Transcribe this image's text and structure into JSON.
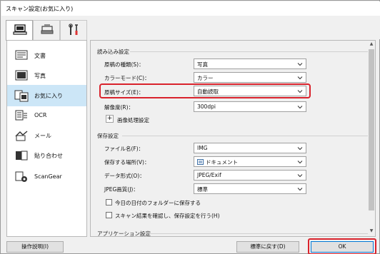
{
  "window": {
    "title": "スキャン設定(お気に入り)"
  },
  "tabs": [
    {
      "icon": "scanner-computer-icon",
      "active": true
    },
    {
      "icon": "scanner-icon",
      "active": false
    },
    {
      "icon": "tools-icon",
      "active": false
    }
  ],
  "sidebar": {
    "items": [
      {
        "label": "文書",
        "icon": "document-icon"
      },
      {
        "label": "写真",
        "icon": "photo-icon"
      },
      {
        "label": "お気に入り",
        "icon": "favorites-icon",
        "active": true
      },
      {
        "label": "OCR",
        "icon": "ocr-icon"
      },
      {
        "label": "メール",
        "icon": "mail-icon"
      },
      {
        "label": "貼り合わせ",
        "icon": "stitch-icon"
      },
      {
        "label": "ScanGear",
        "icon": "scangear-icon"
      }
    ]
  },
  "scan_options": {
    "title": "読み込み設定",
    "source_type": {
      "label": "原稿の種類(S)：",
      "value": "写真"
    },
    "color_mode": {
      "label": "カラーモード(C)：",
      "value": "カラー"
    },
    "paper_size": {
      "label": "原稿サイズ(E)：",
      "value": "自動読取"
    },
    "resolution": {
      "label": "解像度(R)：",
      "value": "300dpi"
    },
    "image_processing": {
      "label": "画像処理設定"
    }
  },
  "save_settings": {
    "title": "保存設定",
    "file_name": {
      "label": "ファイル名(F)：",
      "value": "IMG"
    },
    "save_in": {
      "label": "保存する場所(V)：",
      "value": "ドキュメント"
    },
    "data_format": {
      "label": "データ形式(O)：",
      "value": "JPEG/Exif"
    },
    "jpeg_quality": {
      "label": "JPEG画質(J)：",
      "value": "標準"
    },
    "subfolder": {
      "label": "今日の日付のフォルダーに保存する",
      "checked": false
    },
    "check_results": {
      "label": "スキャン結果を確認し、保存設定を行う(H)",
      "checked": false
    }
  },
  "app_settings": {
    "title": "アプリケーション設定"
  },
  "footer": {
    "instructions": "操作説明(I)",
    "defaults": "標準に戻す(D)",
    "ok": "OK"
  },
  "colors": {
    "highlight": "#d9222c",
    "selected": "#cce6f7"
  }
}
